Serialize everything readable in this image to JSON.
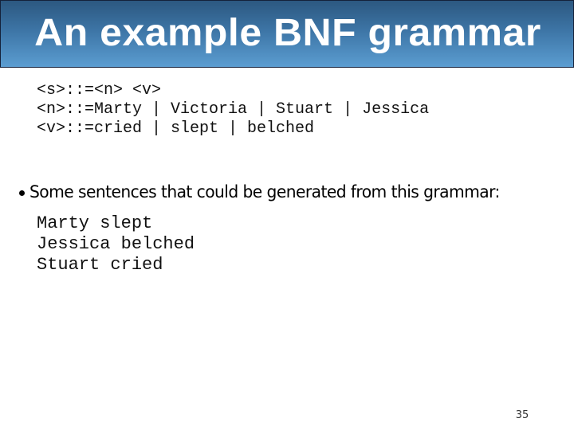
{
  "slide": {
    "title": "An example BNF grammar",
    "colors": {
      "title_bar_top": "#2c5880",
      "title_bar_bottom": "#5b9dd1",
      "title_bar_border": "#14213a",
      "title_text": "#ffffff",
      "body_text": "#000000"
    },
    "grammar_rules": [
      "<s>::=<n> <v>",
      "<n>::=Marty | Victoria | Stuart | Jessica",
      "<v>::=cried | slept | belched"
    ],
    "bullet": {
      "icon": "bullet-dot",
      "text": "Some sentences that could be generated from this grammar:"
    },
    "example_sentences": [
      "Marty slept",
      "Jessica belched",
      "Stuart cried"
    ],
    "page_number": "35"
  }
}
